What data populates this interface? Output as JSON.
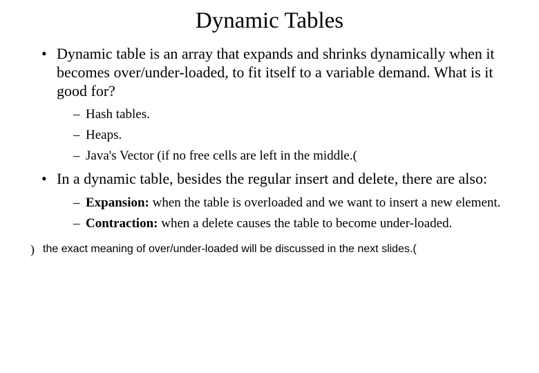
{
  "title": "Dynamic Tables",
  "bullets": {
    "b1": "Dynamic table is an array that expands and shrinks dynamically when it becomes over/under-loaded, to fit itself to a variable demand. What is it good for?",
    "b1_sub": {
      "a": "Hash tables.",
      "b": "Heaps.",
      "c": "Java's Vector (if no free cells are left in the middle.("
    },
    "b2": "In a dynamic table, besides the regular insert and delete, there are also:",
    "b2_sub": {
      "a_label": " Expansion:",
      "a_rest": " when the table is overloaded and we want to insert a new element.",
      "b_label": "Contraction:",
      "b_rest": " when a delete causes the table to become under-loaded."
    }
  },
  "footnote": "the exact meaning of over/under-loaded will be discussed in the next slides.("
}
